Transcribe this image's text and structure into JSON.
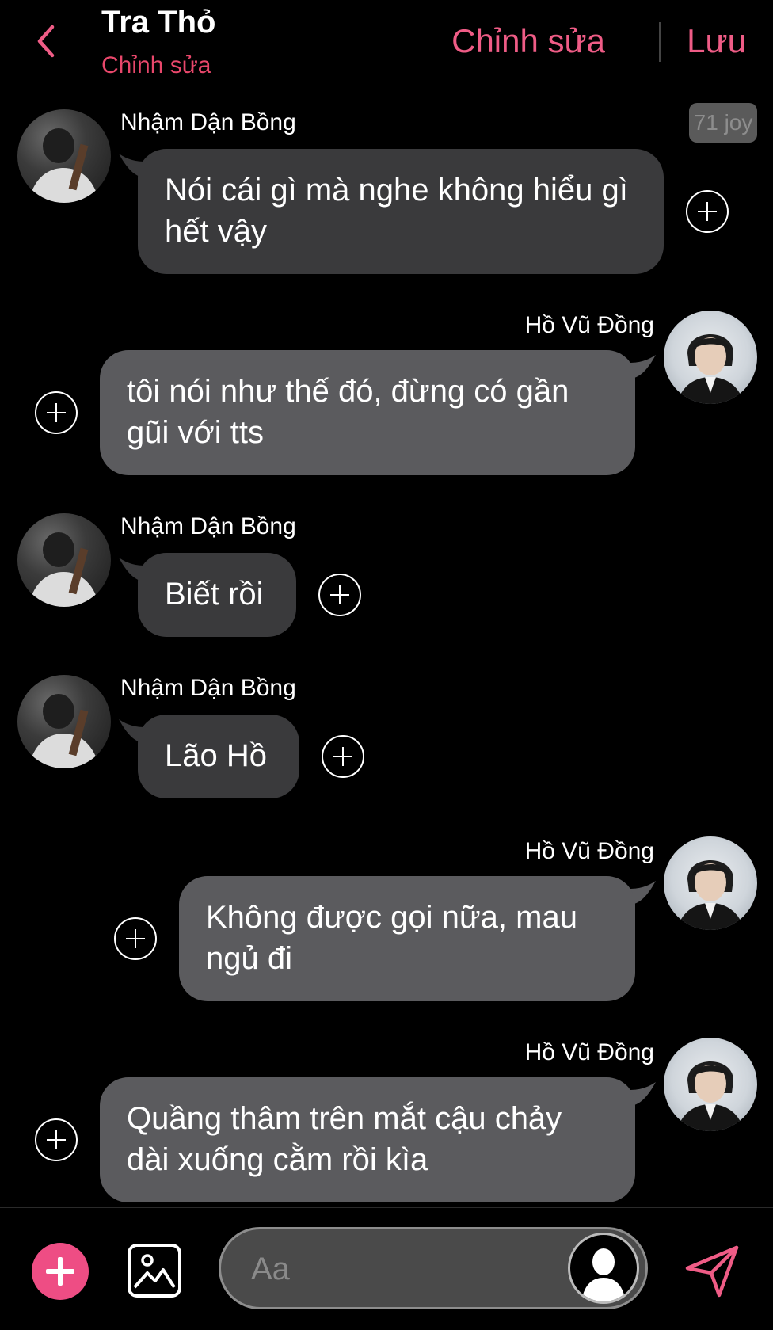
{
  "header": {
    "title": "Tra Thỏ",
    "subtitle": "Chỉnh sửa",
    "edit_label": "Chỉnh sửa",
    "save_label": "Lưu"
  },
  "badge": "71 joy",
  "messages": [
    {
      "sender": "Nhậm Dận Bồng",
      "text": "Nói cái gì mà nghe không hiểu gì hết vậy"
    },
    {
      "sender": "Hồ Vũ Đồng",
      "text": "tôi nói như thế đó, đừng có gần gũi với tts"
    },
    {
      "sender": "Nhậm Dận Bồng",
      "text": "Biết rồi"
    },
    {
      "sender": "Nhậm Dận Bồng",
      "text": "Lão Hồ"
    },
    {
      "sender": "Hồ Vũ Đồng",
      "text": "Không được gọi nữa, mau ngủ đi"
    },
    {
      "sender": "Hồ Vũ Đồng",
      "text": "Quầng thâm trên mắt cậu chảy dài xuống cằm rồi kìa"
    }
  ],
  "composer": {
    "placeholder": "Aa"
  },
  "colors": {
    "accent": "#ef5c86",
    "subtitle": "#e8476b",
    "bubble_left": "#3a3a3c",
    "bubble_right": "#5b5b5e",
    "add_button": "#ee4d84"
  },
  "icons": {
    "back": "chevron-left-icon",
    "plus": "plus-circle-icon",
    "image": "image-icon",
    "profile": "profile-icon",
    "send": "send-icon"
  }
}
